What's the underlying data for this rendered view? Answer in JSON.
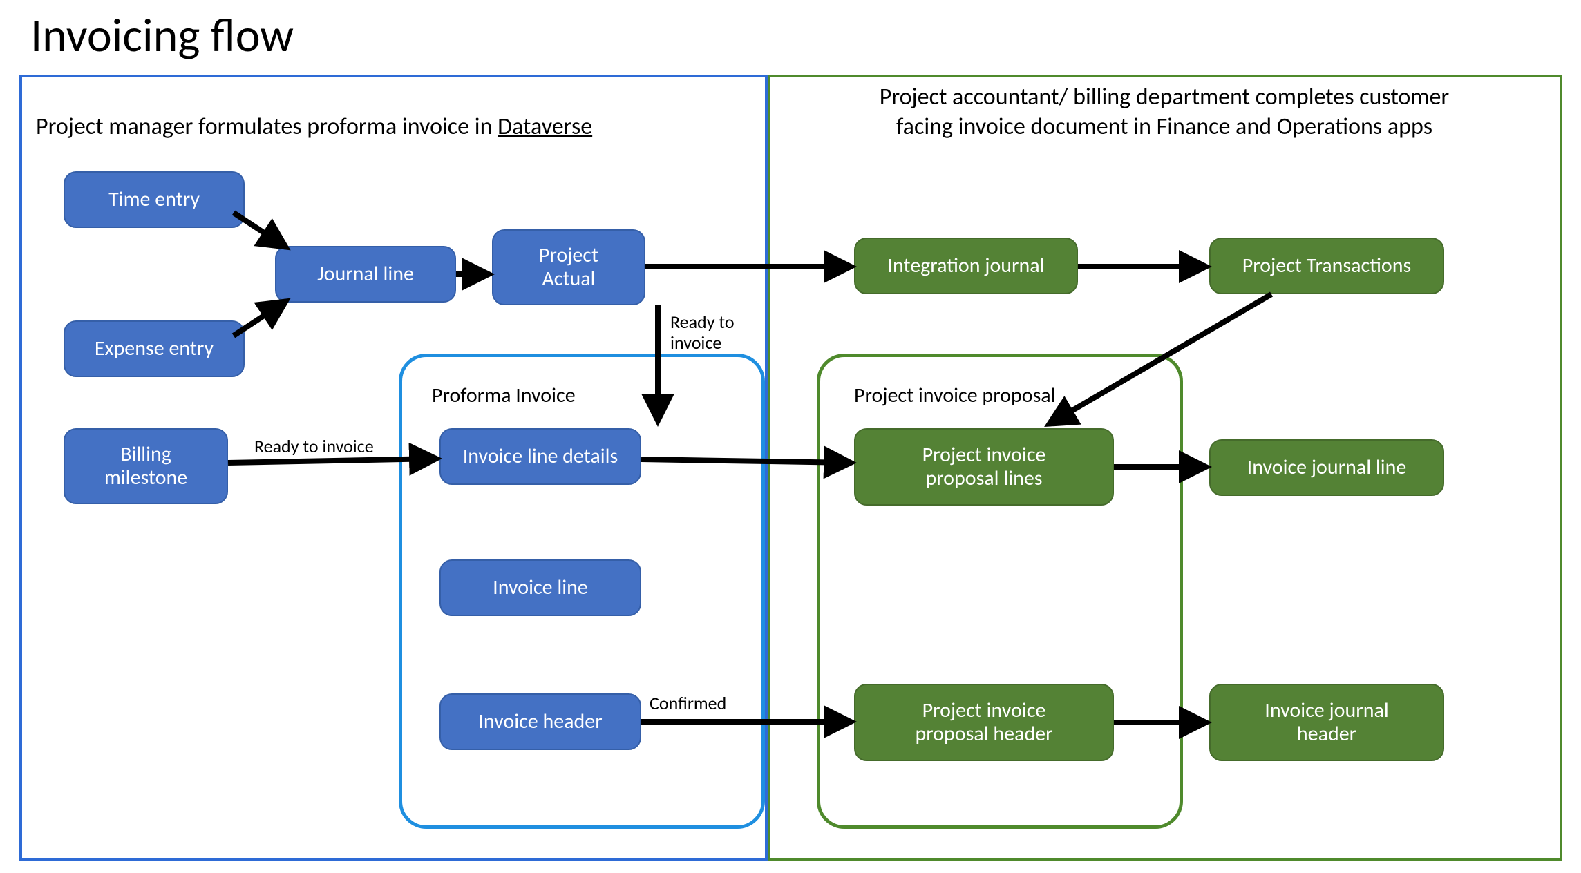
{
  "title": "Invoicing flow",
  "left_panel": {
    "label_prefix": "Project manager formulates proforma invoice in ",
    "label_underlined": "Dataverse",
    "inner_label": "Proforma Invoice",
    "nodes": {
      "time_entry": "Time entry",
      "expense_entry": "Expense entry",
      "journal_line": "Journal line",
      "project_actual": "Project\nActual",
      "billing_milestone": "Billing\nmilestone",
      "invoice_line_details": "Invoice line details",
      "invoice_line": "Invoice line",
      "invoice_header": "Invoice header"
    }
  },
  "right_panel": {
    "label": "Project accountant/ billing department completes customer\nfacing invoice document in Finance and Operations apps",
    "inner_label": "Project invoice proposal",
    "nodes": {
      "integration_journal": "Integration journal",
      "project_transactions": "Project Transactions",
      "proposal_lines": "Project invoice\nproposal lines",
      "proposal_header": "Project invoice\nproposal header",
      "invoice_journal_line": "Invoice journal line",
      "invoice_journal_header": "Invoice journal\nheader"
    }
  },
  "edge_labels": {
    "ready_to_invoice_1": "Ready to invoice",
    "ready_to_invoice_2": "Ready to\ninvoice",
    "confirmed": "Confirmed"
  },
  "colors": {
    "blue_node": "#4471c4",
    "green_node": "#548235",
    "blue_border": "#2e6bd6",
    "green_border": "#4f8a2c",
    "arrow": "#000000"
  }
}
